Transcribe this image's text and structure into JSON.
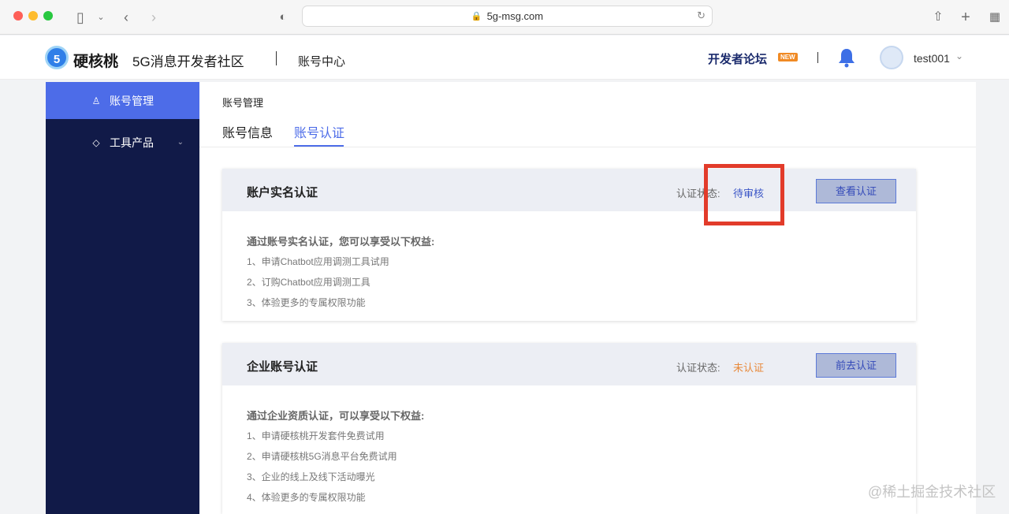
{
  "browser": {
    "url": "5g-msg.com"
  },
  "header": {
    "logo_text": "5",
    "brand": "硬核桃",
    "brand_sub": "5G消息开发者社区",
    "section": "账号中心",
    "forum_link": "开发者论坛",
    "new_badge": "NEW",
    "username": "test001"
  },
  "sidebar": {
    "items": [
      {
        "label": "账号管理",
        "icon": "user-icon"
      },
      {
        "label": "工具产品",
        "icon": "cube-icon"
      }
    ]
  },
  "main": {
    "section_title": "账号管理",
    "tabs": [
      {
        "label": "账号信息"
      },
      {
        "label": "账号认证"
      }
    ]
  },
  "cards": [
    {
      "title": "账户实名认证",
      "status_label": "认证状态:",
      "status_value": "待审核",
      "status_color": "#3a55c7",
      "button": "查看认证",
      "intro": "通过账号实名认证，您可以享受以下权益:",
      "benefits": [
        "1、申请Chatbot应用调测工具试用",
        "2、订购Chatbot应用调测工具",
        "3、体验更多的专属权限功能"
      ]
    },
    {
      "title": "企业账号认证",
      "status_label": "认证状态:",
      "status_value": "未认证",
      "status_color": "#e8893a",
      "button": "前去认证",
      "intro": "通过企业资质认证，可以享受以下权益:",
      "benefits": [
        "1、申请硬核桃开发套件免费试用",
        "2、申请硬核桃5G消息平台免费试用",
        "3、企业的线上及线下活动曝光",
        "4、体验更多的专属权限功能"
      ]
    }
  ],
  "watermark": "@稀土掘金技术社区"
}
